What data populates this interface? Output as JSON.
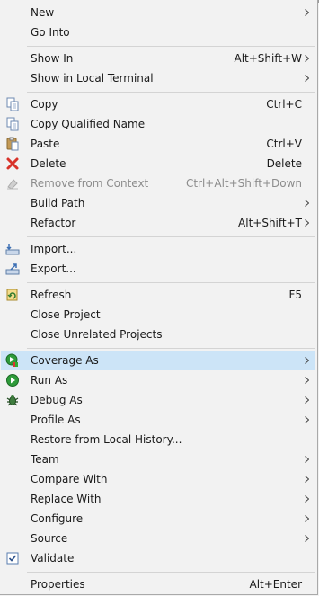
{
  "menu": {
    "items": [
      {
        "label": "New",
        "shortcut": "",
        "submenu": true,
        "icon": "",
        "disabled": false
      },
      {
        "label": "Go Into",
        "shortcut": "",
        "submenu": false,
        "icon": "",
        "disabled": false
      },
      {
        "label": "Show In",
        "shortcut": "Alt+Shift+W",
        "submenu": true,
        "icon": "",
        "disabled": false
      },
      {
        "label": "Show in Local Terminal",
        "shortcut": "",
        "submenu": true,
        "icon": "",
        "disabled": false
      },
      {
        "label": "Copy",
        "shortcut": "Ctrl+C",
        "submenu": false,
        "icon": "copy-icon",
        "disabled": false
      },
      {
        "label": "Copy Qualified Name",
        "shortcut": "",
        "submenu": false,
        "icon": "copy-qualified-name-icon",
        "disabled": false
      },
      {
        "label": "Paste",
        "shortcut": "Ctrl+V",
        "submenu": false,
        "icon": "paste-icon",
        "disabled": false
      },
      {
        "label": "Delete",
        "shortcut": "Delete",
        "submenu": false,
        "icon": "delete-icon",
        "disabled": false
      },
      {
        "label": "Remove from Context",
        "shortcut": "Ctrl+Alt+Shift+Down",
        "submenu": false,
        "icon": "remove-from-context-icon",
        "disabled": true
      },
      {
        "label": "Build Path",
        "shortcut": "",
        "submenu": true,
        "icon": "",
        "disabled": false
      },
      {
        "label": "Refactor",
        "shortcut": "Alt+Shift+T",
        "submenu": true,
        "icon": "",
        "disabled": false
      },
      {
        "label": "Import...",
        "shortcut": "",
        "submenu": false,
        "icon": "import-icon",
        "disabled": false
      },
      {
        "label": "Export...",
        "shortcut": "",
        "submenu": false,
        "icon": "export-icon",
        "disabled": false
      },
      {
        "label": "Refresh",
        "shortcut": "F5",
        "submenu": false,
        "icon": "refresh-icon",
        "disabled": false
      },
      {
        "label": "Close Project",
        "shortcut": "",
        "submenu": false,
        "icon": "",
        "disabled": false
      },
      {
        "label": "Close Unrelated Projects",
        "shortcut": "",
        "submenu": false,
        "icon": "",
        "disabled": false
      },
      {
        "label": "Coverage As",
        "shortcut": "",
        "submenu": true,
        "icon": "coverage-icon",
        "disabled": false,
        "highlighted": true
      },
      {
        "label": "Run As",
        "shortcut": "",
        "submenu": true,
        "icon": "run-icon",
        "disabled": false
      },
      {
        "label": "Debug As",
        "shortcut": "",
        "submenu": true,
        "icon": "debug-bug-icon",
        "disabled": false
      },
      {
        "label": "Profile As",
        "shortcut": "",
        "submenu": true,
        "icon": "",
        "disabled": false
      },
      {
        "label": "Restore from Local History...",
        "shortcut": "",
        "submenu": false,
        "icon": "",
        "disabled": false
      },
      {
        "label": "Team",
        "shortcut": "",
        "submenu": true,
        "icon": "",
        "disabled": false
      },
      {
        "label": "Compare With",
        "shortcut": "",
        "submenu": true,
        "icon": "",
        "disabled": false
      },
      {
        "label": "Replace With",
        "shortcut": "",
        "submenu": true,
        "icon": "",
        "disabled": false
      },
      {
        "label": "Configure",
        "shortcut": "",
        "submenu": true,
        "icon": "",
        "disabled": false
      },
      {
        "label": "Source",
        "shortcut": "",
        "submenu": true,
        "icon": "",
        "disabled": false
      },
      {
        "label": "Validate",
        "shortcut": "",
        "submenu": false,
        "icon": "checkbox-checked-icon",
        "disabled": false
      },
      {
        "label": "Properties",
        "shortcut": "Alt+Enter",
        "submenu": false,
        "icon": "",
        "disabled": false
      }
    ]
  },
  "colors": {
    "menu_background": "#f2f2f2",
    "highlight": "#cce4f7",
    "separator": "#d4d4d4",
    "disabled_text": "#8c8c8c"
  }
}
